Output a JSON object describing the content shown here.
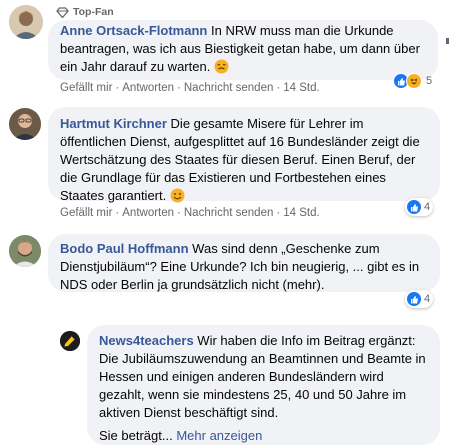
{
  "comments": [
    {
      "badge": "Top-Fan",
      "author": "Anne Ortsack-Flotmann",
      "text": "In NRW muss man die Urkunde beantragen, was ich aus Biestigkeit getan habe, um dann über ein Jahr darauf zu warten.",
      "actions": {
        "like": "Gefällt mir",
        "reply": "Antworten",
        "message": "Nachricht senden",
        "time": "14 Std."
      },
      "reactions": {
        "icons": [
          "like-icon",
          "haha-icon"
        ],
        "count": "5"
      }
    },
    {
      "author": "Hartmut Kirchner",
      "text": "Die gesamte Misere für Lehrer im öffentlichen Dienst, aufgesplittet auf 16 Bundesländer zeigt die Wertschätzung des Staates für diesen Beruf. Einen Beruf, der die Grundlage für das Existieren und Fortbestehen eines Staates garantiert.",
      "actions": {
        "like": "Gefällt mir",
        "reply": "Antworten",
        "message": "Nachricht senden",
        "time": "14 Std."
      },
      "reactions": {
        "icons": [
          "like-icon"
        ],
        "count": "4"
      }
    },
    {
      "author": "Bodo Paul Hoffmann",
      "text": "Was sind denn „Geschenke zum Dienstjubiläum“? Eine Urkunde? Ich bin neugierig, ... gibt es in NDS oder Berlin ja grundsätzlich nicht (mehr).",
      "reactions": {
        "icons": [
          "like-icon"
        ],
        "count": "4"
      }
    }
  ],
  "reply": {
    "author": "News4teachers",
    "text": "Wir haben die Info im Beitrag ergänzt: Die Jubiläumszuwendung an Beamtinnen und Beamte in Hessen und einigen anderen Bundesländern wird gezahlt, wenn sie mindestens 25, 40 und 50 Jahre im aktiven Dienst beschäftigt sind.",
    "text2": "Sie beträgt...",
    "more": "Mehr anzeigen"
  },
  "colors": {
    "link": "#385898",
    "like": "#1877f2",
    "haha": "#f7b125",
    "bubble": "#f0f2f5",
    "meta": "#65676b"
  }
}
